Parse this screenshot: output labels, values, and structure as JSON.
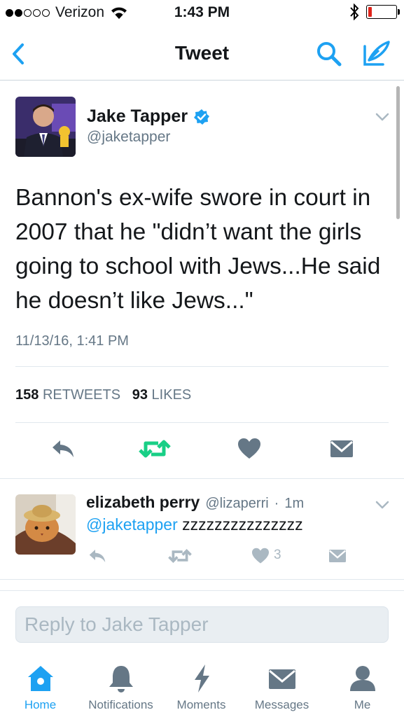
{
  "status_bar": {
    "carrier": "Verizon",
    "time": "1:43 PM",
    "signal_bars_filled": 2,
    "signal_bars_total": 5,
    "battery_level": 0.15
  },
  "nav": {
    "title": "Tweet"
  },
  "tweet": {
    "author_name": "Jake Tapper",
    "author_handle": "@jaketapper",
    "text": "Bannon's ex-wife swore in court in 2007 that he \"didn’t want the girls going to school with Jews...He said he doesn’t like Jews...\"",
    "timestamp": "11/13/16, 1:41 PM",
    "retweets_count": "158",
    "retweets_label": "RETWEETS",
    "likes_count": "93",
    "likes_label": "LIKES"
  },
  "reply": {
    "author_name": "elizabeth perry",
    "author_handle": "@lizaperri",
    "separator": "·",
    "time_ago": "1m",
    "mention": "@jaketapper",
    "text": "zzzzzzzzzzzzzzz",
    "like_count": "3"
  },
  "reply_input": {
    "placeholder": "Reply to Jake Tapper"
  },
  "tab_bar": {
    "items": [
      {
        "label": "Home",
        "icon": "home-icon",
        "active": true
      },
      {
        "label": "Notifications",
        "icon": "bell-icon",
        "active": false
      },
      {
        "label": "Moments",
        "icon": "lightning-icon",
        "active": false
      },
      {
        "label": "Messages",
        "icon": "envelope-icon",
        "active": false
      },
      {
        "label": "Me",
        "icon": "person-icon",
        "active": false
      }
    ]
  },
  "colors": {
    "accent": "#1da1f2",
    "retweet_green": "#19cf86",
    "action_gray": "#657786",
    "muted_gray": "#aab8c2",
    "battery_red": "#e0241b"
  }
}
